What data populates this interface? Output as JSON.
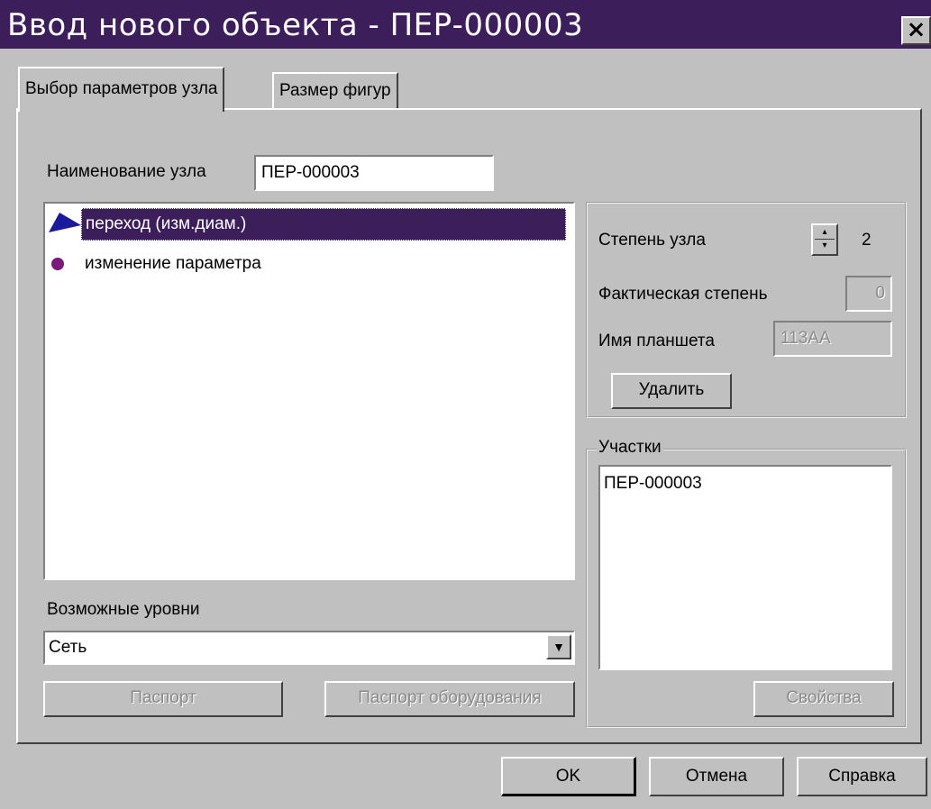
{
  "window": {
    "title": "Ввод нового объекта - ПЕР-000003",
    "close_label": "×"
  },
  "tabs": [
    {
      "label": "Выбор параметров узла",
      "active": true
    },
    {
      "label": "Размер фигур",
      "active": false
    }
  ],
  "node_name": {
    "label": "Наименование узла",
    "value": "ПЕР-000003"
  },
  "node_types": [
    {
      "label": "переход (изм.диам.)",
      "icon": "triangle-icon",
      "color": "#1a1a9c",
      "selected": true
    },
    {
      "label": "изменение параметра",
      "icon": "dot-icon",
      "color": "#7a1a7a",
      "selected": false
    }
  ],
  "properties": {
    "degree_label": "Степень узла",
    "degree_value": "2",
    "actual_degree_label": "Фактическая степень",
    "actual_degree_value": "0",
    "tablet_label": "Имя планшета",
    "tablet_value": "113АА",
    "delete_button": "Удалить"
  },
  "sections": {
    "group_label": "Участки",
    "items": [
      "ПЕР-000003"
    ],
    "properties_button": "Свойства"
  },
  "levels": {
    "label": "Возможные уровни",
    "selected": "Сеть"
  },
  "buttons": {
    "passport": "Паспорт",
    "equipment_passport": "Паспорт оборудования",
    "ok": "OK",
    "cancel": "Отмена",
    "help": "Справка"
  },
  "colors": {
    "title_bar": "#3c1e5a",
    "selection": "#3c1e5a",
    "face": "#c0c0c0"
  }
}
